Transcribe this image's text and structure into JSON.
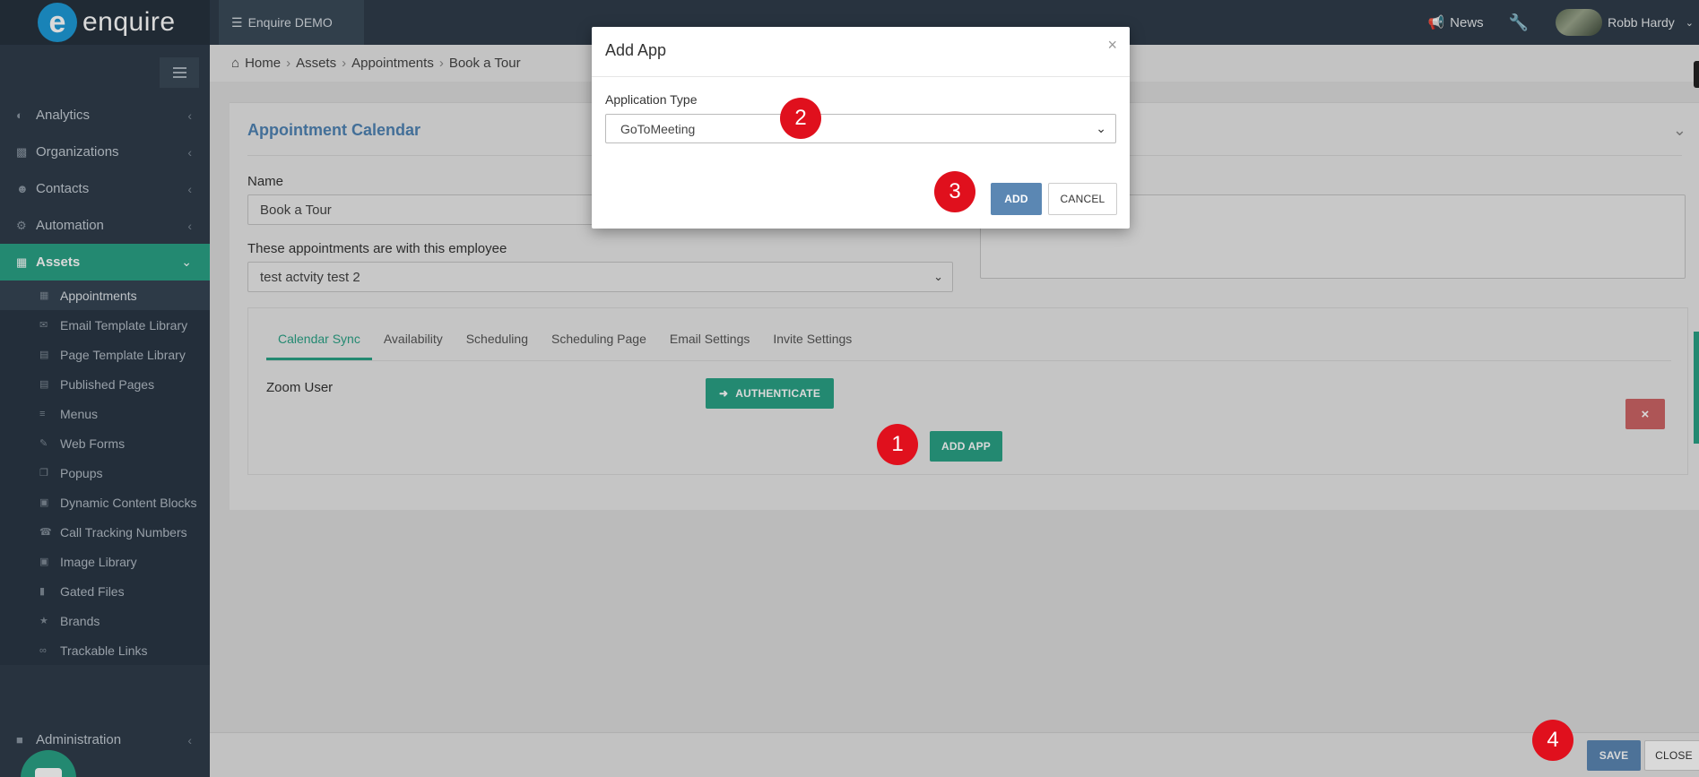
{
  "app": {
    "logo_text": "enquire",
    "logo_letter": "e",
    "workspace": "Enquire DEMO"
  },
  "topbar": {
    "news": "News",
    "user": "Robb Hardy"
  },
  "sidebar": {
    "items": [
      {
        "label": "Analytics"
      },
      {
        "label": "Organizations"
      },
      {
        "label": "Contacts"
      },
      {
        "label": "Automation"
      },
      {
        "label": "Assets"
      }
    ],
    "sub_items": [
      {
        "label": "Appointments"
      },
      {
        "label": "Email Template Library"
      },
      {
        "label": "Page Template Library"
      },
      {
        "label": "Published Pages"
      },
      {
        "label": "Menus"
      },
      {
        "label": "Web Forms"
      },
      {
        "label": "Popups"
      },
      {
        "label": "Dynamic Content Blocks"
      },
      {
        "label": "Call Tracking Numbers"
      },
      {
        "label": "Image Library"
      },
      {
        "label": "Gated Files"
      },
      {
        "label": "Brands"
      },
      {
        "label": "Trackable Links"
      }
    ],
    "admin": "Administration"
  },
  "breadcrumb": [
    "Home",
    "Assets",
    "Appointments",
    "Book a Tour"
  ],
  "panel": {
    "title": "Appointment Calendar",
    "name_label": "Name",
    "name_value": "Book a Tour",
    "employee_label": "These appointments are with this employee",
    "employee_value": "test actvity test 2"
  },
  "tabs": [
    "Calendar Sync",
    "Availability",
    "Scheduling",
    "Scheduling Page",
    "Email Settings",
    "Invite Settings"
  ],
  "calendar_sync": {
    "zoom_label": "Zoom User",
    "authenticate": "AUTHENTICATE",
    "add_app": "ADD APP",
    "remove": "×"
  },
  "footer": {
    "save": "SAVE",
    "close": "CLOSE"
  },
  "modal": {
    "title": "Add App",
    "close": "×",
    "type_label": "Application Type",
    "type_value": "GoToMeeting",
    "add": "ADD",
    "cancel": "CANCEL"
  },
  "markers": [
    "1",
    "2",
    "3",
    "4"
  ],
  "colors": {
    "accent": "#2aa185",
    "primary": "#5b87b3",
    "danger": "#cd6466",
    "sidebar": "#2f3d4b",
    "marker": "#e0101d"
  }
}
